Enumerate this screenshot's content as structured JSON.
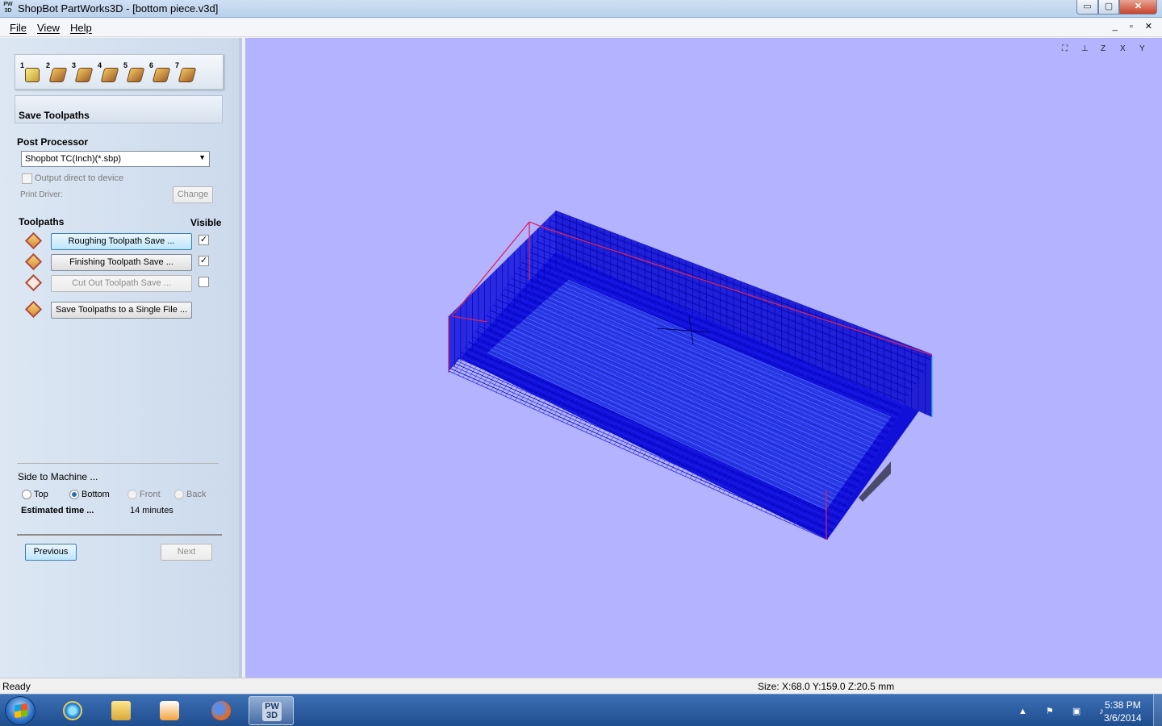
{
  "window": {
    "title": "ShopBot PartWorks3D - [bottom piece.v3d]",
    "icon_text": "PW 3D",
    "controls": {
      "minimize": "▭",
      "maximize": "▢",
      "close": "✕"
    }
  },
  "menu": {
    "items": [
      {
        "label": "File"
      },
      {
        "label": "View"
      },
      {
        "label": "Help"
      }
    ],
    "mdi_controls": "_ ▫ ✕"
  },
  "panel": {
    "steps": [
      {
        "num": "1",
        "icon": "model-size-icon"
      },
      {
        "num": "2",
        "icon": "import-icon"
      },
      {
        "num": "3",
        "icon": "position-icon"
      },
      {
        "num": "4",
        "icon": "roughing-icon"
      },
      {
        "num": "5",
        "icon": "cutout-icon"
      },
      {
        "num": "6",
        "icon": "preview-icon"
      },
      {
        "num": "7",
        "icon": "save-icon"
      }
    ],
    "section_title": "Save Toolpaths",
    "post_processor_label": "Post Processor",
    "post_processor_value": "Shopbot TC(Inch)(*.sbp)",
    "output_direct_label": "Output direct to device",
    "print_driver_label": "Print Driver:",
    "change_label": "Change",
    "toolpaths_label": "Toolpaths",
    "visible_label": "Visible",
    "toolpaths": [
      {
        "label": "Roughing Toolpath Save ...",
        "visible": true,
        "enabled": true
      },
      {
        "label": "Finishing Toolpath Save ...",
        "visible": true,
        "enabled": true
      },
      {
        "label": "Cut Out Toolpath Save ...",
        "visible": false,
        "enabled": false
      }
    ],
    "save_single_label": "Save Toolpaths to a Single File ...",
    "side_label": "Side to Machine ...",
    "sides": [
      {
        "label": "Top",
        "selected": false,
        "enabled": true
      },
      {
        "label": "Bottom",
        "selected": true,
        "enabled": true
      },
      {
        "label": "Front",
        "selected": false,
        "enabled": false
      },
      {
        "label": "Back",
        "selected": false,
        "enabled": false
      }
    ],
    "estimated_label": "Estimated time ...",
    "estimated_value": "14 minutes",
    "previous_label": "Previous",
    "next_label": "Next",
    "check_mark": "✓"
  },
  "viewport": {
    "background": "#b3b3ff",
    "toolpath_color": "#0000c8",
    "boundary_color": "#d8235a",
    "view_tools": [
      {
        "name": "zoom-fit-icon",
        "glyph": "⛶"
      },
      {
        "name": "iso-view-icon",
        "glyph": "⊥"
      },
      {
        "name": "z-view-icon",
        "glyph": "Z"
      },
      {
        "name": "x-view-icon",
        "glyph": "X"
      },
      {
        "name": "y-view-icon",
        "glyph": "Y"
      }
    ]
  },
  "status": {
    "ready": "Ready",
    "size": "Size: X:68.0 Y:159.0 Z:20.5 mm"
  },
  "taskbar": {
    "items": [
      {
        "name": "internet-explorer",
        "label": ""
      },
      {
        "name": "windows-explorer",
        "label": ""
      },
      {
        "name": "media-player",
        "label": ""
      },
      {
        "name": "firefox",
        "label": ""
      },
      {
        "name": "partworks3d",
        "label": "PW 3D"
      }
    ],
    "tray": "▲ ⚑ ▣ ♪",
    "time": "5:38 PM",
    "date": "3/6/2014"
  }
}
